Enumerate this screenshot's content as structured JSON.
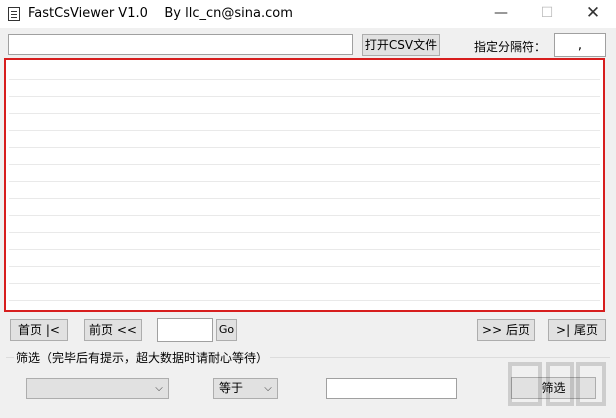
{
  "window": {
    "title": "FastCsViewer V1.0    By llc_cn@sina.com",
    "minimize_glyph": "—",
    "maximize_glyph": "☐",
    "close_glyph": "✕"
  },
  "toolbar": {
    "path_value": "",
    "open_button_label": "打开CSV文件",
    "separator_label": "指定分隔符：",
    "separator_value": ","
  },
  "pagination": {
    "first_label": "首页 |<",
    "prev_label": "前页 <<",
    "page_value": "",
    "go_label": "Go",
    "next_label": ">> 后页",
    "last_label": ">| 尾页"
  },
  "filter": {
    "legend": "筛选（完毕后有提示，超大数据时请耐心等待）",
    "field_value": "",
    "operator_value": "等于",
    "value_text": "",
    "button_label": "筛选"
  },
  "icons": {
    "app": "csv-app-icon",
    "dropdown": "chevron-down-icon"
  },
  "colors": {
    "grid_border": "#d71e1e",
    "window_bg": "#f0f0f0",
    "button_bg": "#e1e1e1"
  }
}
